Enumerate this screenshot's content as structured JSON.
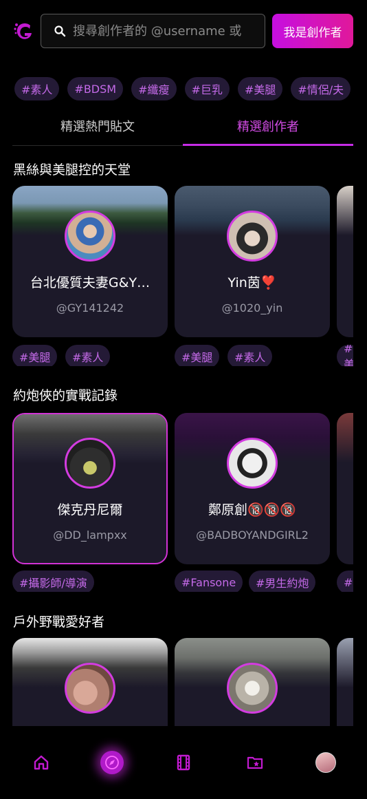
{
  "header": {
    "search_placeholder": "搜尋創作者的 @username 或",
    "creator_button": "我是創作者"
  },
  "categories": [
    "#素人",
    "#BDSM",
    "#纖瘦",
    "#巨乳",
    "#美腿",
    "#情侶/夫"
  ],
  "tabs": [
    {
      "label": "精選熱門貼文",
      "active": false
    },
    {
      "label": "精選創作者",
      "active": true
    }
  ],
  "sections": [
    {
      "title": "黑絲與美腿控的天堂",
      "creators": [
        {
          "name": "台北優質夫妻G&Y…",
          "handle": "@GY141242",
          "tags": [
            "#美腿",
            "#素人"
          ]
        },
        {
          "name": "Yin茵❣️",
          "handle": "@1020_yin",
          "tags": [
            "#美腿",
            "#素人"
          ]
        }
      ],
      "peek_tag": "#美"
    },
    {
      "title": "約炮俠的實戰記錄",
      "creators": [
        {
          "name": "傑克丹尼爾",
          "handle": "@DD_lampxx",
          "tags": [
            "#攝影師/導演"
          ]
        },
        {
          "name": "鄭原創🔞🔞🔞",
          "handle": "@BADBOYANDGIRL2",
          "tags": [
            "#Fansone",
            "#男生約炮"
          ]
        }
      ],
      "peek_tag": "#F"
    },
    {
      "title": "戶外野戰愛好者",
      "creators": [
        {
          "name": "",
          "handle": "",
          "tags": []
        },
        {
          "name": "",
          "handle": "",
          "tags": []
        }
      ]
    }
  ],
  "nav": {
    "items": [
      "home-icon",
      "explore-compass-icon",
      "film-icon",
      "starred-folder-icon",
      "profile-avatar"
    ],
    "active": "explore-compass-icon"
  },
  "colors": {
    "accent": "#c62ce6",
    "chip_bg": "#241a36",
    "chip_text": "#c46ae8",
    "card_bg": "#1c1929"
  }
}
